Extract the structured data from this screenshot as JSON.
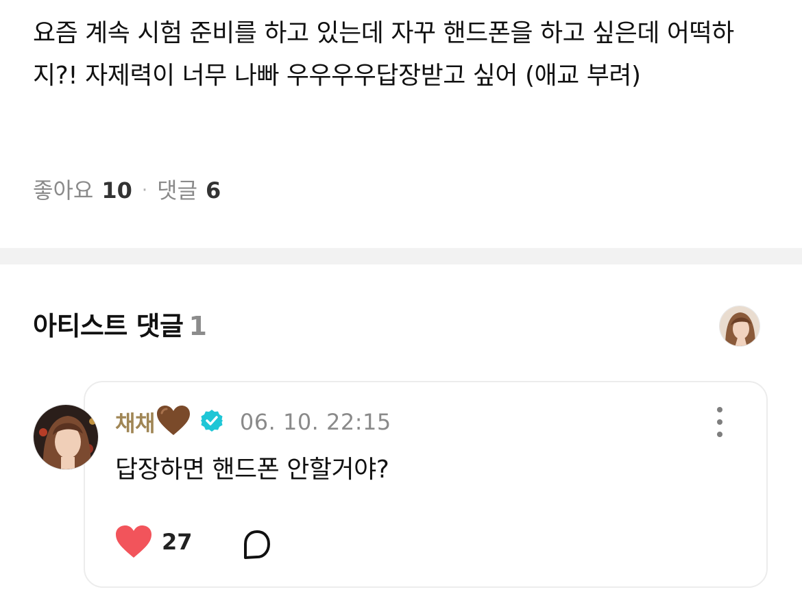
{
  "post": {
    "body": "요즘 계속 시험 준비를 하고 있는데 자꾸 핸드폰을 하고 싶은데 어떡하지?! 자제력이 너무 나빠 우우우우답장받고 싶어 (애교 부려)",
    "likes_label": "좋아요",
    "likes_count": "10",
    "separator": "·",
    "comments_label": "댓글",
    "comments_count": "6"
  },
  "artist_comments": {
    "title": "아티스트 댓글",
    "count": "1"
  },
  "comment": {
    "author": "채채",
    "author_emoji": "🤎",
    "timestamp": "06. 10. 22:15",
    "text": "답장하면 핸드폰 안할거야?",
    "like_count": "27"
  },
  "icons": {
    "verified": "verified-badge-icon",
    "more": "more-vertical-icon",
    "like": "heart-icon",
    "reply": "speech-bubble-icon"
  },
  "colors": {
    "author_name": "#a08655",
    "verified_badge": "#1fc6d6",
    "heart": "#f2545b",
    "emoji_heart": "#7a4a2a",
    "muted_text": "#8a8a8a",
    "divider_band": "#f2f2f2"
  }
}
